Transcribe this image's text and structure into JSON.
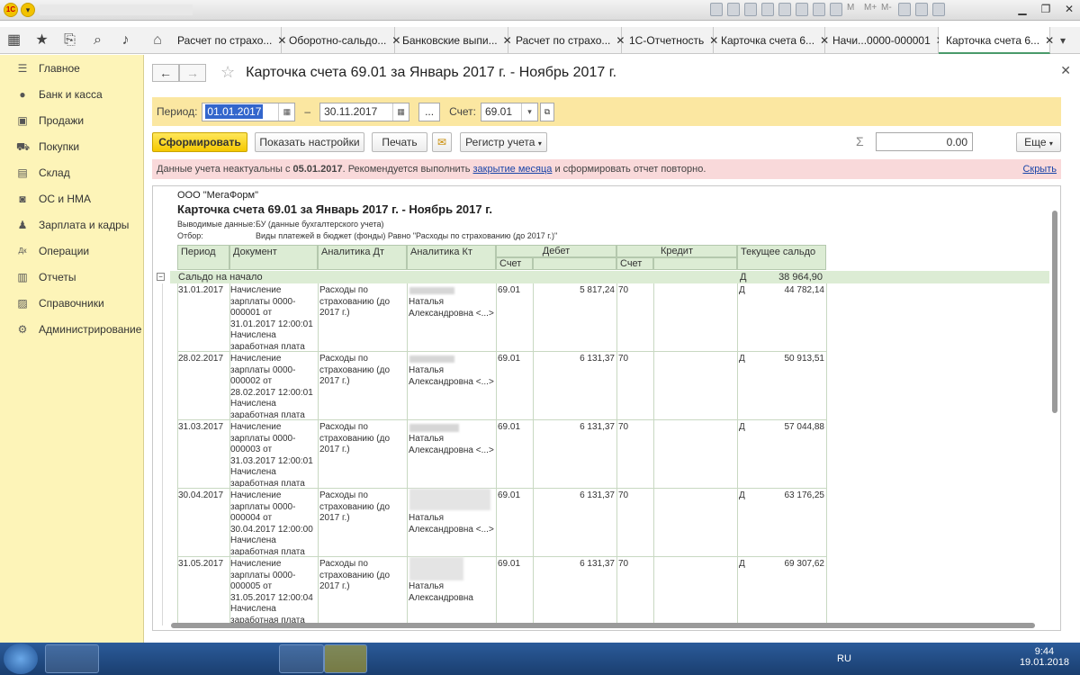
{
  "titlebar": {
    "icons": [
      "save-icon",
      "print-icon",
      "preview-icon",
      "mail-icon",
      "attach-icon",
      "calc-icon",
      "calendar-icon",
      "compare-icon",
      "zoom-icon",
      "info-icon",
      "menu-icon"
    ],
    "m1": "M",
    "m2": "M+",
    "m3": "M-"
  },
  "tabs": [
    {
      "label": "Расчет по страхо..."
    },
    {
      "label": "Оборотно-сальдо..."
    },
    {
      "label": "Банковские выпи..."
    },
    {
      "label": "Расчет по страхо..."
    },
    {
      "label": "1С-Отчетность"
    },
    {
      "label": "Карточка счета 6..."
    },
    {
      "label": "Начи...0000-000001"
    },
    {
      "label": "Карточка счета 6..."
    }
  ],
  "sidebar": {
    "items": [
      {
        "label": "Главное",
        "icon": "menu-icon"
      },
      {
        "label": "Банк и касса",
        "icon": "bank-icon"
      },
      {
        "label": "Продажи",
        "icon": "sales-icon"
      },
      {
        "label": "Покупки",
        "icon": "cart-icon"
      },
      {
        "label": "Склад",
        "icon": "warehouse-icon"
      },
      {
        "label": "ОС и НМА",
        "icon": "assets-icon"
      },
      {
        "label": "Зарплата и кадры",
        "icon": "person-icon"
      },
      {
        "label": "Операции",
        "icon": "operations-icon"
      },
      {
        "label": "Отчеты",
        "icon": "reports-icon"
      },
      {
        "label": "Справочники",
        "icon": "books-icon"
      },
      {
        "label": "Администрирование",
        "icon": "gear-icon"
      }
    ]
  },
  "header": {
    "title": "Карточка счета 69.01 за Январь 2017 г. - Ноябрь 2017 г."
  },
  "filter": {
    "period_label": "Период:",
    "date_from": "01.01.2017",
    "dash": "–",
    "date_to": "30.11.2017",
    "dots": "...",
    "account_label": "Счет:",
    "account": "69.01"
  },
  "toolbar": {
    "generate": "Сформировать",
    "settings": "Показать настройки",
    "print": "Печать",
    "register": "Регистр учета",
    "sum_value": "0.00",
    "more": "Еще"
  },
  "warning": {
    "text_before": "Данные учета неактуальны с ",
    "date": "05.01.2017",
    "text_mid": ". Рекомендуется выполнить ",
    "link": "закрытие месяца",
    "text_after": " и сформировать отчет повторно.",
    "hide": "Скрыть"
  },
  "report": {
    "company": "ООО \"МегаФорм\"",
    "title": "Карточка счета 69.01 за Январь 2017 г. - Ноябрь 2017 г.",
    "output_label": "Выводимые данные:",
    "output_value": "БУ (данные бухгалтерского учета)",
    "filter_label": "Отбор:",
    "filter_value": "Виды платежей в бюджет (фонды) Равно \"Расходы по страхованию (до 2017 г.)\"",
    "columns": {
      "period": "Период",
      "document": "Документ",
      "an_dt": "Аналитика Дт",
      "an_kt": "Аналитика Кт",
      "debit": "Дебет",
      "credit": "Кредит",
      "balance": "Текущее сальдо",
      "account": "Счет",
      "account2": "Счет"
    },
    "opening": {
      "label": "Сальдо на начало",
      "dk": "Д",
      "value": "38 964,90"
    },
    "rows": [
      {
        "date": "31.01.2017",
        "doc": "Начисление зарплаты 0000-000001 от 31.01.2017 12:00:01 Начислена заработная плата",
        "an_dt": "Расходы по страхованию (до 2017 г.)",
        "an_kt": "Наталья Александровна <...>",
        "dt_acc": "69.01",
        "dt_sum": "5 817,24",
        "kt_acc": "70",
        "dk": "Д",
        "bal": "44 782,14"
      },
      {
        "date": "28.02.2017",
        "doc": "Начисление зарплаты 0000-000002 от 28.02.2017 12:00:01 Начислена заработная плата",
        "an_dt": "Расходы по страхованию (до 2017 г.)",
        "an_kt": "Наталья Александровна <...>",
        "dt_acc": "69.01",
        "dt_sum": "6 131,37",
        "kt_acc": "70",
        "dk": "Д",
        "bal": "50 913,51"
      },
      {
        "date": "31.03.2017",
        "doc": "Начисление зарплаты 0000-000003 от 31.03.2017 12:00:01 Начислена заработная плата",
        "an_dt": "Расходы по страхованию (до 2017 г.)",
        "an_kt": "Наталья Александровна <...>",
        "dt_acc": "69.01",
        "dt_sum": "6 131,37",
        "kt_acc": "70",
        "dk": "Д",
        "bal": "57 044,88"
      },
      {
        "date": "30.04.2017",
        "doc": "Начисление зарплаты 0000-000004 от 30.04.2017 12:00:00 Начислена заработная плата",
        "an_dt": "Расходы по страхованию (до 2017 г.)",
        "an_kt": "Наталья Александровна <...>",
        "dt_acc": "69.01",
        "dt_sum": "6 131,37",
        "kt_acc": "70",
        "dk": "Д",
        "bal": "63 176,25"
      },
      {
        "date": "31.05.2017",
        "doc": "Начисление зарплаты 0000-000005 от 31.05.2017 12:00:04 Начислена заработная плата",
        "an_dt": "Расходы по страхованию (до 2017 г.)",
        "an_kt": "Наталья Александровна",
        "dt_acc": "69.01",
        "dt_sum": "6 131,37",
        "kt_acc": "70",
        "dk": "Д",
        "bal": "69 307,62"
      }
    ]
  },
  "taskbar": {
    "lang": "RU",
    "time": "9:44",
    "date": "19.01.2018"
  }
}
